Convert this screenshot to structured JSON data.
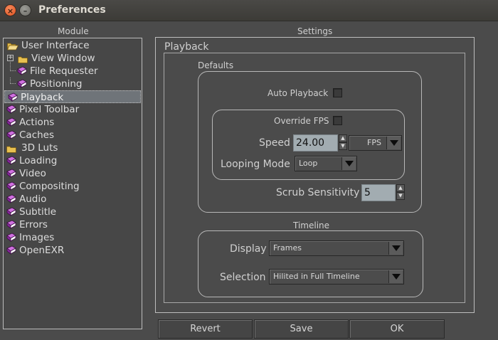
{
  "window": {
    "title": "Preferences",
    "close_glyph": "×",
    "min_glyph": "–"
  },
  "module": {
    "header": "Module",
    "items": [
      {
        "label": "User Interface",
        "icon": "folder-open-icon"
      },
      {
        "label": "View Window",
        "icon": "folder-icon"
      },
      {
        "label": "File Requester",
        "icon": "book-icon"
      },
      {
        "label": "Positioning",
        "icon": "book-icon"
      },
      {
        "label": "Playback",
        "icon": "book-icon",
        "selected": true
      },
      {
        "label": "Pixel Toolbar",
        "icon": "book-icon"
      },
      {
        "label": "Actions",
        "icon": "book-icon"
      },
      {
        "label": "Caches",
        "icon": "book-icon"
      },
      {
        "label": "3D Luts",
        "icon": "folder-icon"
      },
      {
        "label": "Loading",
        "icon": "book-icon"
      },
      {
        "label": "Video",
        "icon": "book-icon"
      },
      {
        "label": "Compositing",
        "icon": "book-icon"
      },
      {
        "label": "Audio",
        "icon": "book-icon"
      },
      {
        "label": "Subtitle",
        "icon": "book-icon"
      },
      {
        "label": "Errors",
        "icon": "book-icon"
      },
      {
        "label": "Images",
        "icon": "book-icon"
      },
      {
        "label": "OpenEXR",
        "icon": "book-icon"
      }
    ]
  },
  "settings": {
    "header": "Settings",
    "section_title": "Playback",
    "defaults": {
      "title": "Defaults",
      "auto_playback_label": "Auto Playback",
      "override_fps_label": "Override FPS",
      "speed_label": "Speed",
      "speed_value": "24.00",
      "speed_unit": "FPS",
      "looping_mode_label": "Looping Mode",
      "looping_mode_value": "Loop",
      "scrub_label": "Scrub Sensitivity",
      "scrub_value": "5"
    },
    "timeline": {
      "title": "Timeline",
      "display_label": "Display",
      "display_value": "Frames",
      "selection_label": "Selection",
      "selection_value": "Hilited in Full Timeline"
    }
  },
  "buttons": {
    "revert": "Revert",
    "save": "Save",
    "ok": "OK"
  },
  "colors": {
    "background": "#4b4b4b",
    "selected_row": "#6f7479",
    "book_icon": "#b040c0",
    "folder_icon": "#e8c050",
    "input_bg": "#a2acb1"
  }
}
